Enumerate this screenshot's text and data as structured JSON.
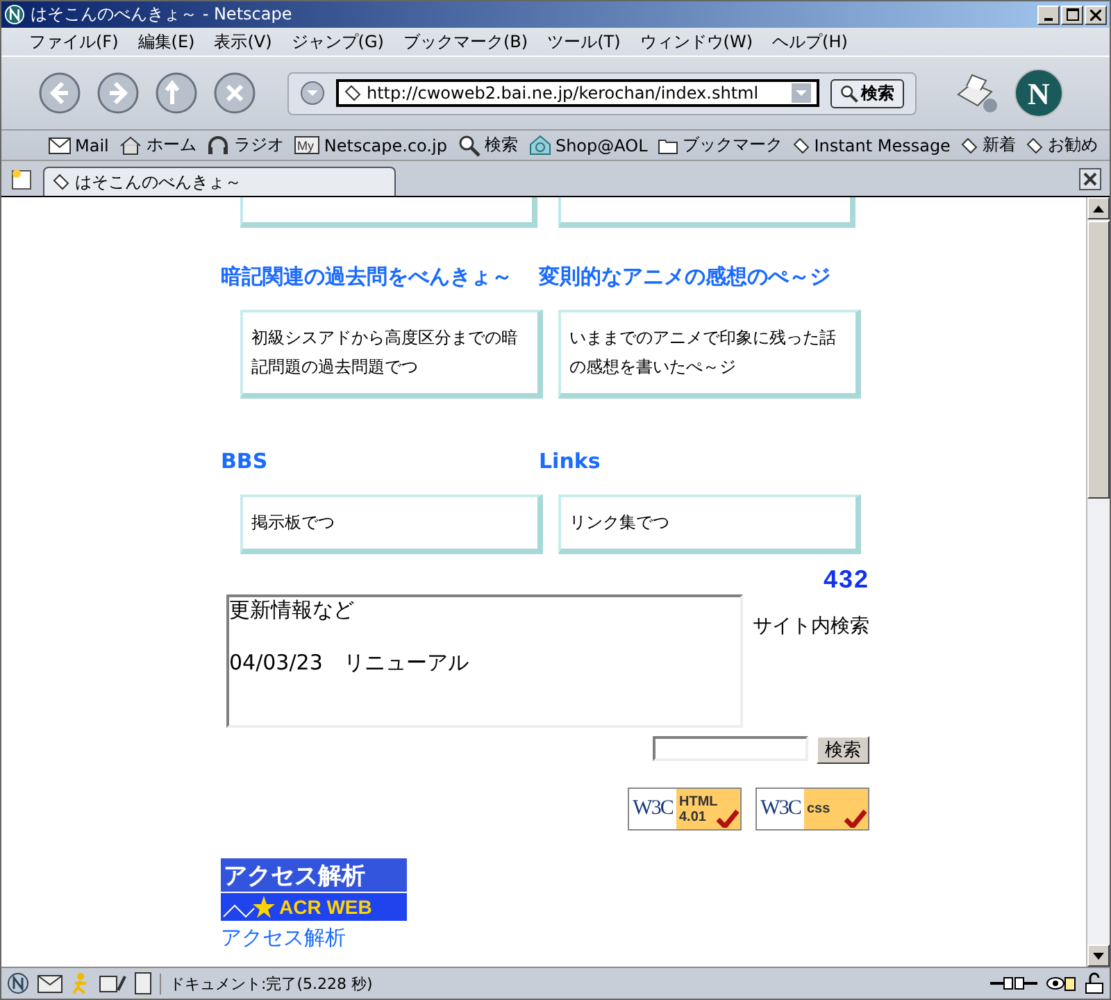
{
  "window": {
    "title": "はそこんのべんきょ～ - Netscape"
  },
  "menu": [
    "ファイル(F)",
    "編集(E)",
    "表示(V)",
    "ジャンプ(G)",
    "ブックマーク(B)",
    "ツール(T)",
    "ウィンドウ(W)",
    "ヘルプ(H)"
  ],
  "navigation": {
    "url": "http://cwoweb2.bai.ne.jp/kerochan/index.shtml",
    "search_button": "検索"
  },
  "personal_toolbar": [
    {
      "kind": "mail",
      "label": "Mail"
    },
    {
      "kind": "home",
      "label": "ホーム"
    },
    {
      "kind": "radio",
      "label": "ラジオ"
    },
    {
      "kind": "my",
      "icon_text": "My",
      "label": "Netscape.co.jp"
    },
    {
      "kind": "search",
      "label": "検索"
    },
    {
      "kind": "shop",
      "label": "Shop@AOL"
    },
    {
      "kind": "folder",
      "label": "ブックマーク"
    },
    {
      "kind": "link",
      "label": "Instant Message"
    },
    {
      "kind": "link",
      "label": "新着"
    },
    {
      "kind": "link",
      "label": "お勧め"
    }
  ],
  "tab": {
    "title": "はそこんのべんきょ～"
  },
  "sections": [
    {
      "heading": "暗記関連の過去問をべんきょ～",
      "description": "初級シスアドから高度区分までの暗記問題の過去問題でつ"
    },
    {
      "heading": "BBS",
      "description": "掲示板でつ"
    },
    {
      "heading": "変則的なアニメの感想のぺ～ジ",
      "description": "いままでのアニメで印象に残った話の感想を書いたぺ～ジ"
    },
    {
      "heading": "Links",
      "description": "リンク集でつ"
    }
  ],
  "counter": "432",
  "news": {
    "title": "更新情報など",
    "entries": [
      "04/03/23　リニューアル"
    ]
  },
  "site_search": {
    "label": "サイト内検索",
    "button": "検索"
  },
  "badges": [
    {
      "logo": "W3C",
      "text": "HTML",
      "version": "4.01"
    },
    {
      "logo": "W3C",
      "text": "css"
    }
  ],
  "throbber": {
    "letter": "N"
  },
  "access_banner": {
    "top": "アクセス解析",
    "bottom": "ACR WEB"
  },
  "access_link": "アクセス解析",
  "status_bar": {
    "text": "ドキュメント:完了(5.228 秒)"
  }
}
